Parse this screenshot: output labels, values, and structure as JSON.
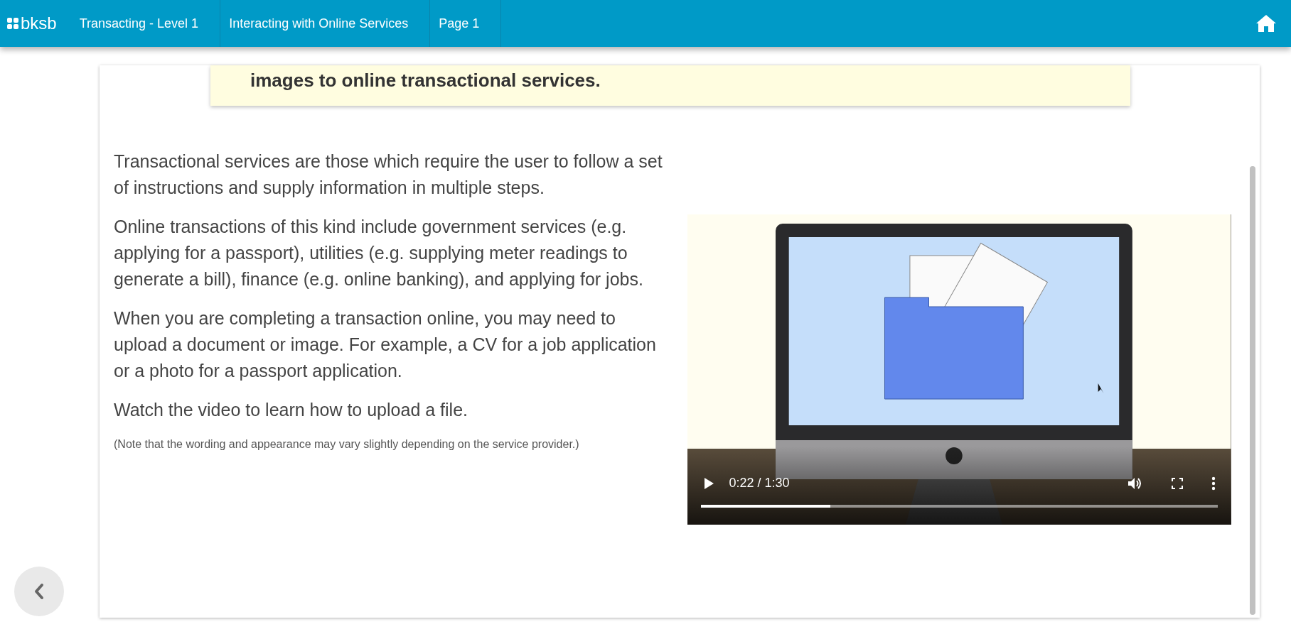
{
  "header": {
    "logo": "bksb",
    "breadcrumbs": [
      {
        "label": "Transacting - Level 1"
      },
      {
        "label": "Interacting with Online Services"
      },
      {
        "label": "Page 1"
      }
    ]
  },
  "banner": {
    "text": "images to online transactional services."
  },
  "paragraphs": [
    "Transactional services are those which require the user to follow a set of instructions and supply information in multiple steps.",
    "Online transactions of this kind include government services (e.g. applying for a passport), utilities (e.g. supplying meter readings to generate a bill), finance (e.g. online banking), and applying for jobs.",
    "When you are completing a transaction online, you may need to upload a document or image. For example, a CV for a job application or a photo for a passport application.",
    "Watch the video to learn how to upload a file."
  ],
  "note": "(Note that the wording and appearance may vary slightly depending on the service provider.)",
  "video": {
    "time": "0:22 / 1:30",
    "progress": {
      "level": 0.25
    }
  }
}
